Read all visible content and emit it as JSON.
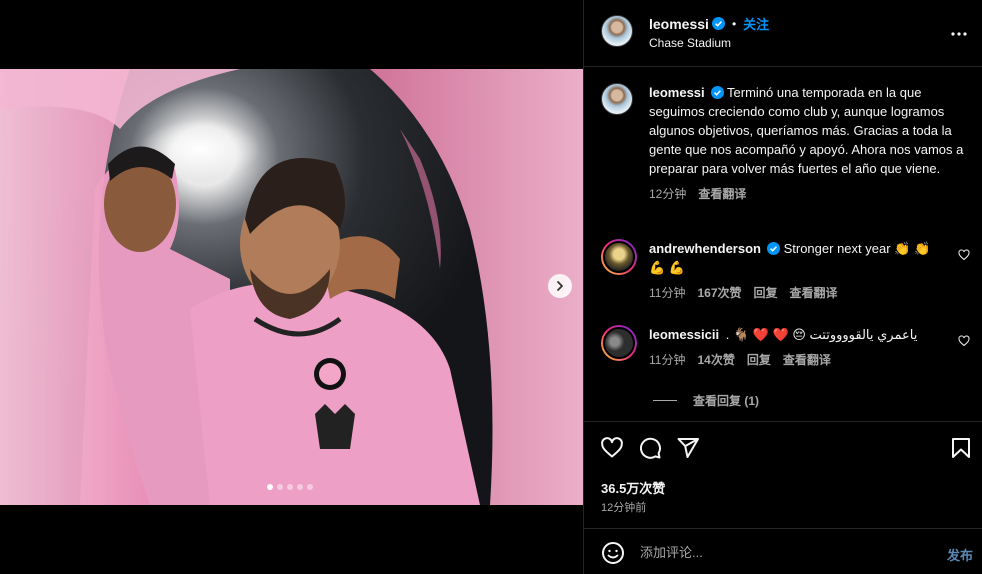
{
  "post": {
    "username": "leomessi",
    "follow_label": "关注",
    "separator": "•",
    "location": "Chase Stadium",
    "caption": "Terminó una temporada en la que seguimos creciendo como club y, aunque logramos algunos objetivos, queríamos más. Gracias a toda la gente que nos acompañó y apoyó. Ahora nos vamos a preparar para volver más fuertes el año que viene.",
    "caption_time": "12分钟",
    "translate_label": "查看翻译",
    "carousel": {
      "slides": 5,
      "active_index": 0
    }
  },
  "comments": [
    {
      "username": "andrewhenderson",
      "verified": true,
      "text": "Stronger next year 👏 👏 💪 💪",
      "time": "11分钟",
      "likes": "167次赞",
      "reply_label": "回复",
      "translate_label": "查看翻译"
    },
    {
      "username": "leomessicii",
      "verified": false,
      "text": ". 🐐 ❤️ ❤️ 😔 ياعمري يالقووووتتت",
      "time": "11分钟",
      "likes": "14次赞",
      "reply_label": "回复",
      "translate_label": "查看翻译"
    }
  ],
  "view_replies_label": "查看回复 (1)",
  "likes_total": "36.5万次赞",
  "posted_ago": "12分钟前",
  "add_comment": {
    "placeholder": "添加评论...",
    "post_label": "发布"
  },
  "colors": {
    "accent": "#0095f6",
    "background": "#000000",
    "jersey_pink": "#f4a6c9"
  },
  "icons": [
    "more-icon",
    "verified-icon",
    "heart-icon",
    "comment-icon",
    "share-icon",
    "bookmark-icon",
    "emoji-icon",
    "chevron-right-icon"
  ]
}
